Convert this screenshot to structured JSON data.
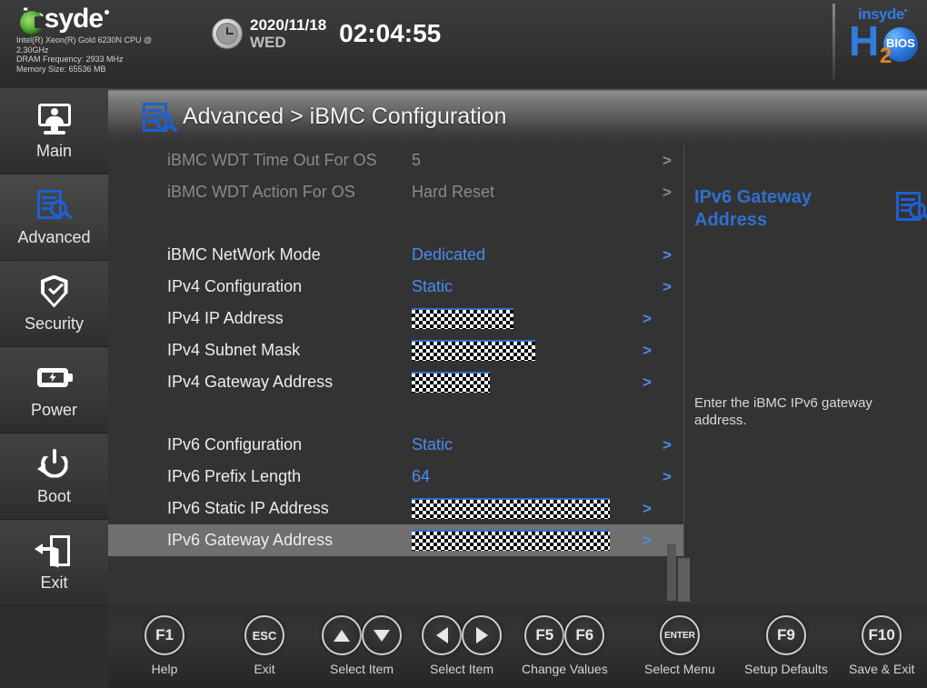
{
  "header": {
    "brand": "insyde",
    "cpu_model": "Intel(R) Xeon(R) Gold 6230N CPU @",
    "cpu_speed": "2.30GHz",
    "dram_frequency": "DRAM Frequency: 2933 MHz",
    "memory_size": "Memory Size: 65536 MB",
    "date": "2020/11/18",
    "weekday": "WED",
    "time": "02:04:55",
    "bios_logo": {
      "insyde": "insyde",
      "h": "H",
      "two": "2",
      "o": "O",
      "bios": "BIOS"
    }
  },
  "sidebar": {
    "items": [
      {
        "label": "Main",
        "icon": "monitor-icon",
        "active": false
      },
      {
        "label": "Advanced",
        "icon": "document-search-icon",
        "active": true
      },
      {
        "label": "Security",
        "icon": "shield-check-icon",
        "active": false
      },
      {
        "label": "Power",
        "icon": "battery-bolt-icon",
        "active": false
      },
      {
        "label": "Boot",
        "icon": "power-restart-icon",
        "active": false
      },
      {
        "label": "Exit",
        "icon": "exit-door-icon",
        "active": false
      }
    ]
  },
  "breadcrumb": {
    "icon": "document-search-icon",
    "text": "Advanced > iBMC Configuration"
  },
  "settings": {
    "rows": [
      {
        "label": "iBMC WDT Time Out For OS",
        "value": "5",
        "arrow": ">",
        "disabled": true,
        "redacted": false,
        "highlight": false
      },
      {
        "label": "iBMC WDT Action For OS",
        "value": "Hard Reset",
        "arrow": ">",
        "disabled": true,
        "redacted": false,
        "highlight": false
      },
      {
        "label": "iBMC NetWork Mode",
        "value": "Dedicated",
        "arrow": ">",
        "disabled": false,
        "redacted": false,
        "highlight": false
      },
      {
        "label": "IPv4 Configuration",
        "value": "Static",
        "arrow": ">",
        "disabled": false,
        "redacted": false,
        "highlight": false
      },
      {
        "label": "IPv4 IP Address",
        "value": "",
        "arrow": ">",
        "disabled": false,
        "redacted": true,
        "redact_width": 112,
        "highlight": false
      },
      {
        "label": "IPv4 Subnet Mask",
        "value": "",
        "arrow": ">",
        "disabled": false,
        "redacted": true,
        "redact_width": 136,
        "highlight": false
      },
      {
        "label": "IPv4 Gateway Address",
        "value": "",
        "arrow": ">",
        "disabled": false,
        "redacted": true,
        "redact_width": 86,
        "highlight": false
      },
      {
        "label": "IPv6 Configuration",
        "value": "Static",
        "arrow": ">",
        "disabled": false,
        "redacted": false,
        "highlight": false
      },
      {
        "label": "IPv6 Prefix Length",
        "value": "64",
        "arrow": ">",
        "disabled": false,
        "redacted": false,
        "highlight": false
      },
      {
        "label": "IPv6 Static IP Address",
        "value": "",
        "arrow": ">",
        "disabled": false,
        "redacted": true,
        "redact_width": 218,
        "highlight": false
      },
      {
        "label": "IPv6 Gateway Address",
        "value": "",
        "arrow": ">",
        "disabled": false,
        "redacted": true,
        "redact_width": 218,
        "highlight": true
      }
    ]
  },
  "help": {
    "title": "IPv6 Gateway Address",
    "icon": "document-search-icon",
    "description": "Enter the iBMC IPv6 gateway address."
  },
  "footer": {
    "keys": [
      {
        "keys": [
          "F1"
        ],
        "label": "Help",
        "type": "text"
      },
      {
        "keys": [
          "ESC"
        ],
        "label": "Exit",
        "type": "text"
      },
      {
        "keys": [
          "up",
          "down"
        ],
        "label": "Select Item",
        "type": "arrow"
      },
      {
        "keys": [
          "left",
          "right"
        ],
        "label": "Select Item",
        "type": "arrow"
      },
      {
        "keys": [
          "F5",
          "F6"
        ],
        "label": "Change Values",
        "type": "text"
      },
      {
        "keys": [
          "ENTER"
        ],
        "label": "Select Menu",
        "type": "text"
      },
      {
        "keys": [
          "F9"
        ],
        "label": "Setup Defaults",
        "type": "text"
      },
      {
        "keys": [
          "F10"
        ],
        "label": "Save & Exit",
        "type": "text"
      }
    ]
  },
  "colors": {
    "accent_blue": "#4a8cf0",
    "logo_blue": "#2f7de0",
    "logo_orange": "#e8821e",
    "disabled_gray": "#8a8a8a",
    "highlight_row": "#6f6f6f"
  }
}
